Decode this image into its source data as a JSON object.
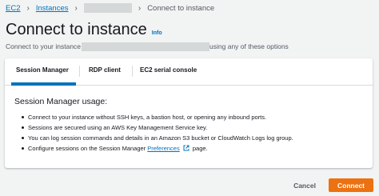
{
  "breadcrumb": {
    "items": [
      "EC2",
      "Instances"
    ],
    "current": "Connect to instance"
  },
  "header": {
    "title": "Connect to instance",
    "info_label": "Info",
    "subtitle_prefix": "Connect to your instance",
    "subtitle_suffix": "using any of these options"
  },
  "tabs": [
    {
      "label": "Session Manager",
      "active": true
    },
    {
      "label": "RDP client",
      "active": false
    },
    {
      "label": "EC2 serial console",
      "active": false
    }
  ],
  "content": {
    "title": "Session Manager usage:",
    "bullets": [
      "Connect to your instance without SSH keys, a bastion host, or opening any inbound ports.",
      "Sessions are secured using an AWS Key Management Service key.",
      "You can log session commands and details in an Amazon S3 bucket or CloudWatch Logs log group."
    ],
    "last_bullet_prefix": "Configure sessions on the Session Manager",
    "last_bullet_link": "Preferences",
    "last_bullet_suffix": "page."
  },
  "footer": {
    "cancel_label": "Cancel",
    "connect_label": "Connect"
  },
  "colors": {
    "link": "#0073bb",
    "primary_button": "#ec7211",
    "background": "#f2f3f3"
  }
}
